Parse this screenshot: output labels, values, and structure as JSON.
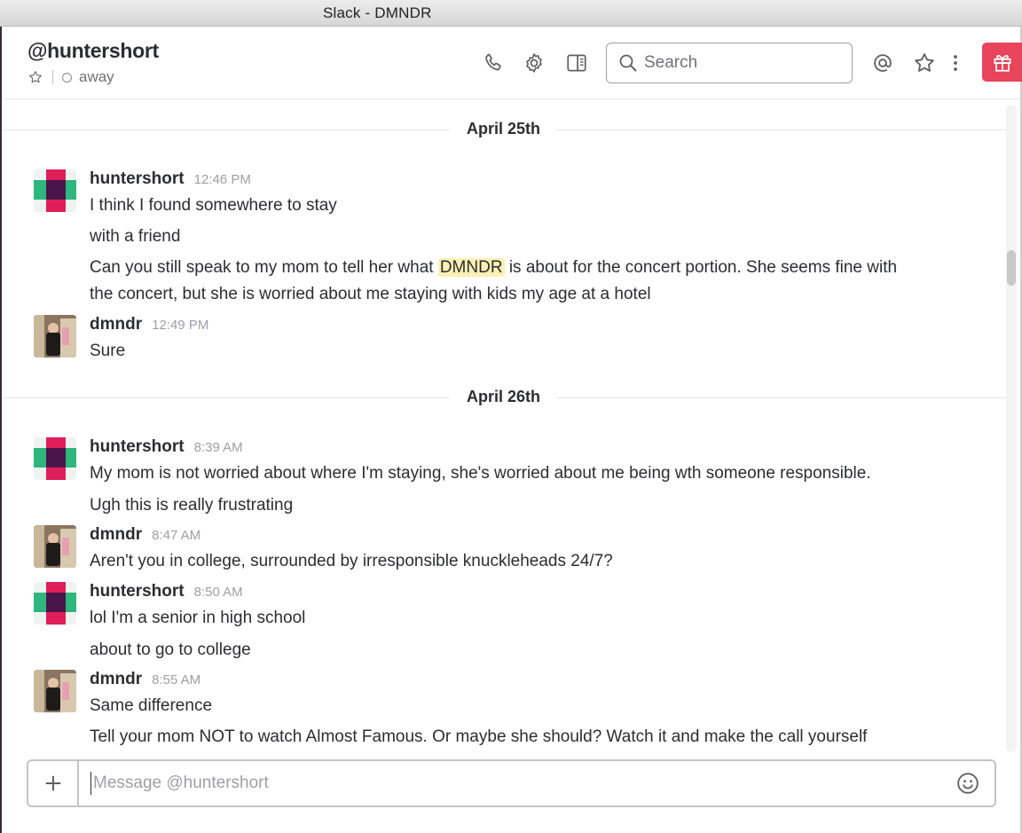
{
  "window": {
    "title": "Slack - DMNDR"
  },
  "header": {
    "channel_name": "@huntershort",
    "presence": "away",
    "search_placeholder": "Search",
    "icons": [
      "phone-icon",
      "gear-icon",
      "sidebar-toggle-icon",
      "search-icon",
      "mention-icon",
      "star-icon",
      "more-icon",
      "gift-icon"
    ]
  },
  "days": [
    {
      "label": "April 25th"
    },
    {
      "label": "April 26th"
    }
  ],
  "messages": [
    {
      "author": "huntershort",
      "time": "12:46 PM",
      "avatar": "huntershort-avatar",
      "lines": [
        "I think I found somewhere to stay",
        "with a friend"
      ],
      "highlight_line": {
        "before": "Can you still speak to my mom to tell her what ",
        "highlight": "DMNDR",
        "after": " is about for the concert portion. She seems fine with",
        "continuation": "the concert, but she is worried about me staying with kids my age at a hotel"
      }
    },
    {
      "author": "dmndr",
      "time": "12:49 PM",
      "avatar": "dmndr-avatar",
      "lines": [
        "Sure"
      ]
    },
    {
      "author": "huntershort",
      "time": "8:39 AM",
      "avatar": "huntershort-avatar",
      "lines": [
        "My mom is not worried about where I'm staying, she's worried about me being wth someone responsible.",
        "Ugh this is really frustrating"
      ]
    },
    {
      "author": "dmndr",
      "time": "8:47 AM",
      "avatar": "dmndr-avatar",
      "lines": [
        "Aren't you in college, surrounded by irresponsible knuckleheads 24/7?"
      ]
    },
    {
      "author": "huntershort",
      "time": "8:50 AM",
      "avatar": "huntershort-avatar",
      "lines": [
        "lol I'm a senior in high school",
        "about to go to college"
      ]
    },
    {
      "author": "dmndr",
      "time": "8:55 AM",
      "avatar": "dmndr-avatar",
      "lines": [
        "Same difference",
        "Tell your mom NOT to watch Almost Famous. Or maybe she should? Watch it and make the call yourself"
      ]
    }
  ],
  "composer": {
    "placeholder": "Message @huntershort"
  },
  "colors": {
    "accent_red": "#e8445c",
    "highlight": "#fcf0b4",
    "avatar_pink": "#e01e5a",
    "avatar_green": "#2eb67d",
    "avatar_dark": "#4a154b"
  }
}
